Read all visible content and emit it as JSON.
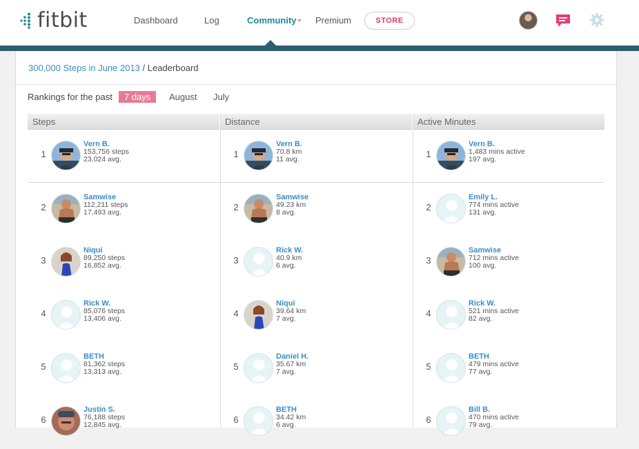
{
  "brand": {
    "name": "fitbit"
  },
  "nav": [
    {
      "label": "Dashboard"
    },
    {
      "label": "Log"
    },
    {
      "label": "Community"
    },
    {
      "label": "Premium"
    }
  ],
  "store_label": "STORE",
  "icons": {
    "messages": "message-icon",
    "settings": "gear-icon"
  },
  "colors": {
    "accent": "#1c8a96",
    "store": "#e0386b",
    "filter_active": "#e97a93",
    "link": "#3a8dc8",
    "header_bar": "#2c5e6d"
  },
  "breadcrumb": {
    "link": "300,000 Steps in June 2013",
    "sep": "/",
    "current": "Leaderboard"
  },
  "rankings": {
    "label": "Rankings for the past",
    "filters": [
      "7 days",
      "August",
      "July"
    ],
    "active_filter": "7 days"
  },
  "columns": [
    {
      "title": "Steps",
      "entries": [
        {
          "rank": "1",
          "name": "Vern B.",
          "value": "153,756 steps",
          "avg": "23,024 avg.",
          "photo": "vern"
        },
        {
          "rank": "2",
          "name": "Samwise",
          "value": "112,211 steps",
          "avg": "17,493 avg.",
          "photo": "samwise"
        },
        {
          "rank": "3",
          "name": "Niqui",
          "value": "89,250 steps",
          "avg": "16,852 avg.",
          "photo": "niqui"
        },
        {
          "rank": "4",
          "name": "Rick W.",
          "value": "85,076 steps",
          "avg": "13,406 avg.",
          "photo": "default"
        },
        {
          "rank": "5",
          "name": "BETH",
          "value": "81,362 steps",
          "avg": "13,313 avg.",
          "photo": "default"
        },
        {
          "rank": "6",
          "name": "Justin S.",
          "value": "76,188 steps",
          "avg": "12,845 avg.",
          "photo": "justin"
        }
      ]
    },
    {
      "title": "Distance",
      "entries": [
        {
          "rank": "1",
          "name": "Vern B.",
          "value": "70.8 km",
          "avg": "11 avg.",
          "photo": "vern"
        },
        {
          "rank": "2",
          "name": "Samwise",
          "value": "49.23 km",
          "avg": "8 avg.",
          "photo": "samwise"
        },
        {
          "rank": "3",
          "name": "Rick W.",
          "value": "40.9 km",
          "avg": "6 avg.",
          "photo": "default"
        },
        {
          "rank": "4",
          "name": "Niqui",
          "value": "39.64 km",
          "avg": "7 avg.",
          "photo": "niqui"
        },
        {
          "rank": "5",
          "name": "Daniel H.",
          "value": "35.67 km",
          "avg": "7 avg.",
          "photo": "default"
        },
        {
          "rank": "6",
          "name": "BETH",
          "value": "34.42 km",
          "avg": "6 avg.",
          "photo": "default"
        }
      ]
    },
    {
      "title": "Active Minutes",
      "entries": [
        {
          "rank": "1",
          "name": "Vern B.",
          "value": "1,483 mins active",
          "avg": "197 avg.",
          "photo": "vern"
        },
        {
          "rank": "2",
          "name": "Emily L.",
          "value": "774 mins active",
          "avg": "131 avg.",
          "photo": "default"
        },
        {
          "rank": "3",
          "name": "Samwise",
          "value": "712 mins active",
          "avg": "100 avg.",
          "photo": "samwise"
        },
        {
          "rank": "4",
          "name": "Rick W.",
          "value": "521 mins active",
          "avg": "82 avg.",
          "photo": "default"
        },
        {
          "rank": "5",
          "name": "BETH",
          "value": "479 mins active",
          "avg": "77 avg.",
          "photo": "default"
        },
        {
          "rank": "6",
          "name": "Bill B.",
          "value": "470 mins active",
          "avg": "79 avg.",
          "photo": "default"
        }
      ]
    }
  ]
}
